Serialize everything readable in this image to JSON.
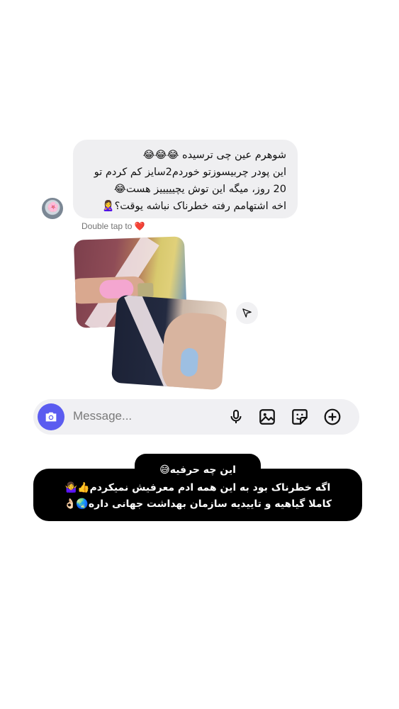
{
  "message": {
    "lines": [
      "شوهرم عین چی ترسیده 😂😂😂",
      "این پودر چربیسوزتو خوردم2سایز کم کردم تو",
      "20 روز، میگه این توش یچیییییز هست😂",
      "اخه اشتهامم رفته خطرناک نباشه یوقت؟🙎‍♀️"
    ],
    "hint": "Double tap to",
    "hint_icon": "heart-icon"
  },
  "composer": {
    "placeholder": "Message...",
    "accent": "#5b5cf0"
  },
  "caption": {
    "line1": "این چه حرفیه😅",
    "line2": "اگه خطرناک بود به این همه ادم معرفیش نمیکردم👍🤷‍♀️",
    "line3": "کاملا گیاهیه و تاییدیه سازمان بهداشت جهانی داره🌏👌🏻"
  }
}
